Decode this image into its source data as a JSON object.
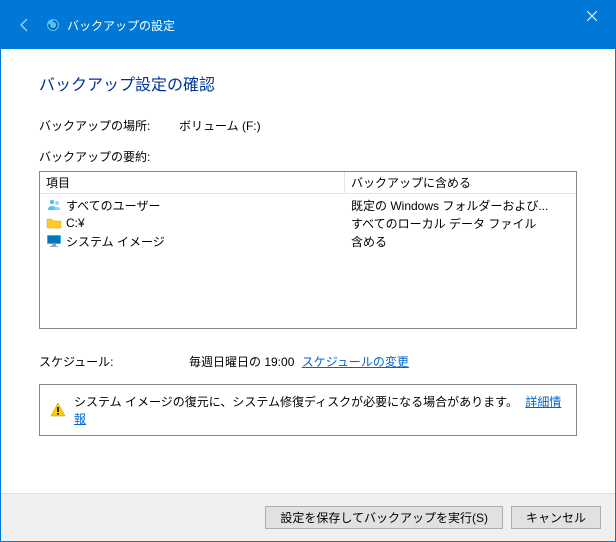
{
  "titlebar": {
    "title": "バックアップの設定"
  },
  "heading": "バックアップ設定の確認",
  "location": {
    "label": "バックアップの場所:",
    "value": "ボリューム (F:)"
  },
  "summary_label": "バックアップの要約:",
  "table": {
    "header_item": "項目",
    "header_included": "バックアップに含める",
    "rows": [
      {
        "icon": "users",
        "item": "すべてのユーザー",
        "included": "既定の Windows フォルダーおよび..."
      },
      {
        "icon": "folder",
        "item": "C:¥",
        "included": "すべてのローカル データ ファイル"
      },
      {
        "icon": "monitor",
        "item": "システム イメージ",
        "included": "含める"
      }
    ]
  },
  "schedule": {
    "label": "スケジュール:",
    "value": "毎週日曜日の 19:00",
    "change_link": "スケジュールの変更"
  },
  "info": {
    "text": "システム イメージの復元に、システム修復ディスクが必要になる場合があります。",
    "link": "詳細情報"
  },
  "footer": {
    "save_run": "設定を保存してバックアップを実行(S)",
    "cancel": "キャンセル"
  }
}
